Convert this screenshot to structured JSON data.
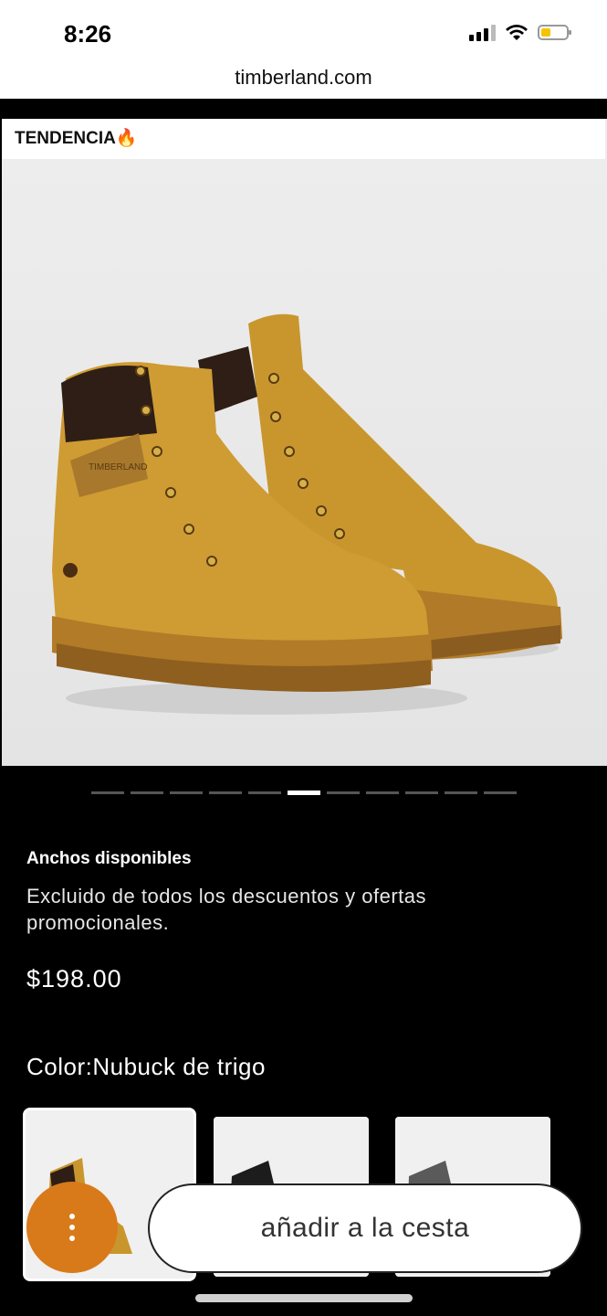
{
  "status_bar": {
    "time": "8:26"
  },
  "browser": {
    "url": "timberland.com"
  },
  "product": {
    "badge": "TENDENCIA🔥",
    "image_icon": "boots-image",
    "carousel": {
      "count": 11,
      "active_index": 5
    },
    "widths_label": "Anchos disponibles",
    "exclusion_note": "Excluido de todos los descuentos y ofertas promocionales.",
    "price": "$198.00",
    "color_label": "Color:Nubuck de trigo",
    "swatches": [
      "wheat-boot-swatch",
      "black-boot-swatch",
      "grey-boot-swatch"
    ]
  },
  "actions": {
    "menu_icon": "more-vertical-icon",
    "add_to_cart": "añadir a la cesta"
  },
  "colors": {
    "accent": "#d87a1a",
    "boot": "#c9962e",
    "background": "#000000"
  }
}
